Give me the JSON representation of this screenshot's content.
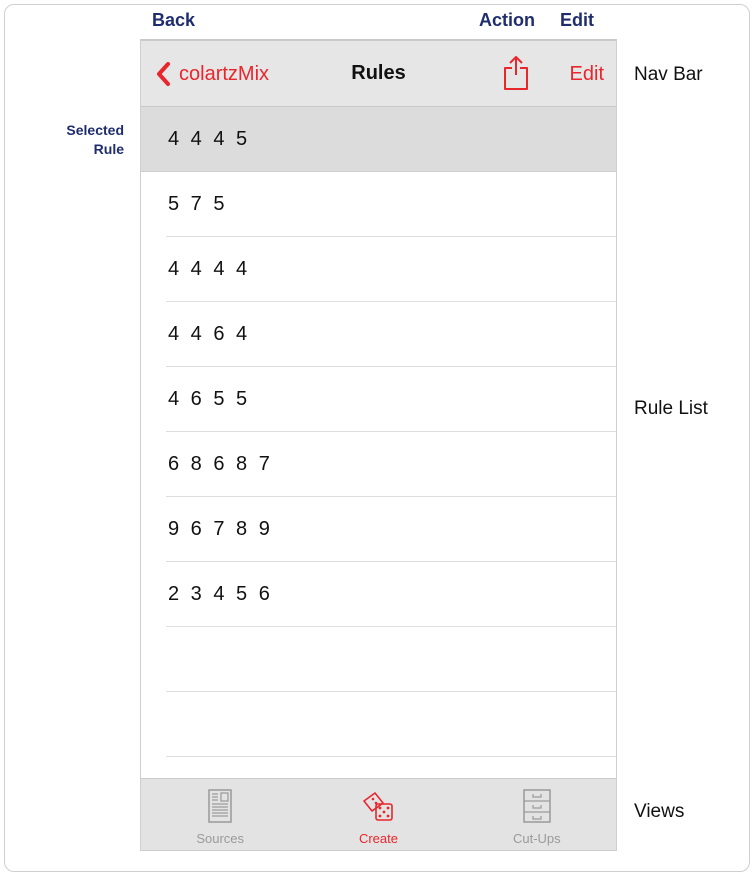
{
  "callouts": {
    "back": "Back",
    "action": "Action",
    "edit": "Edit",
    "selected_rule_line1": "Selected",
    "selected_rule_line2": "Rule",
    "nav_bar": "Nav Bar",
    "rule_list": "Rule List",
    "views": "Views"
  },
  "navbar": {
    "back_label": "colartzMix",
    "title": "Rules",
    "edit_label": "Edit"
  },
  "rules": [
    "4 4 4 5",
    "5 7 5",
    "4 4 4 4",
    "4 4 6 4",
    "4 6 5 5",
    "6 8 6 8 7",
    "9 6 7 8 9",
    "2 3 4 5 6",
    "",
    ""
  ],
  "selected_index": 0,
  "tabs": [
    {
      "label": "Sources",
      "icon": "document-icon",
      "active": false
    },
    {
      "label": "Create",
      "icon": "dice-icon",
      "active": true
    },
    {
      "label": "Cut-Ups",
      "icon": "cabinet-icon",
      "active": false
    }
  ],
  "colors": {
    "accent": "#e8262b",
    "callout": "#1f2d6e",
    "selected_row": "#dcdcdc",
    "navbar_bg": "#e6e6e6"
  }
}
